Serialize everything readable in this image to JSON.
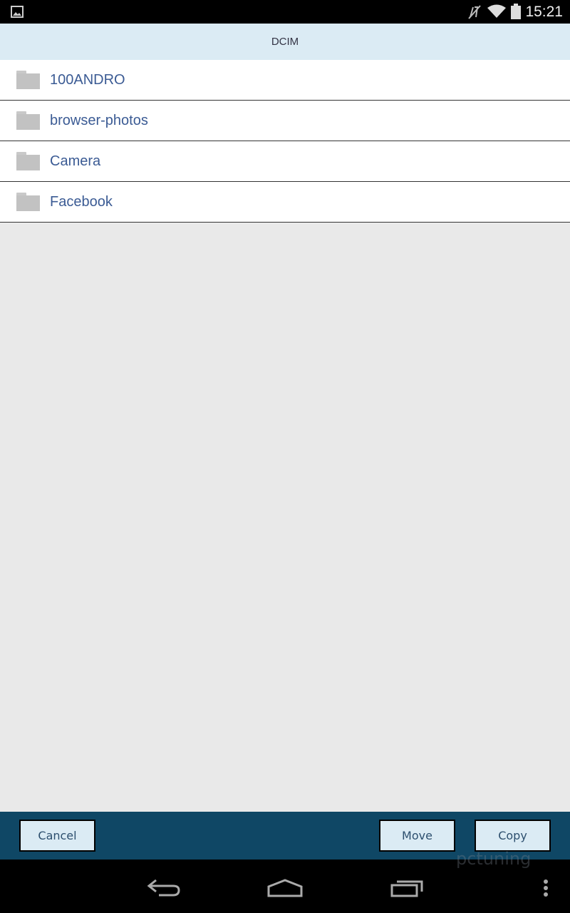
{
  "status_bar": {
    "time": "15:21",
    "icons": [
      "image-notification-icon",
      "mute-icon",
      "wifi-icon",
      "battery-icon"
    ]
  },
  "header": {
    "title": "DCIM"
  },
  "folders": [
    {
      "name": "100ANDRO"
    },
    {
      "name": "browser-photos"
    },
    {
      "name": "Camera"
    },
    {
      "name": "Facebook"
    }
  ],
  "actions": {
    "cancel": "Cancel",
    "move": "Move",
    "copy": "Copy"
  },
  "nav": {
    "icons": [
      "back-icon",
      "home-icon",
      "recents-icon",
      "overflow-menu-icon"
    ]
  },
  "watermark": "pctuning",
  "colors": {
    "header_bg": "#dbebf4",
    "action_bar": "#0f4765",
    "folder_text": "#3b5b94"
  }
}
